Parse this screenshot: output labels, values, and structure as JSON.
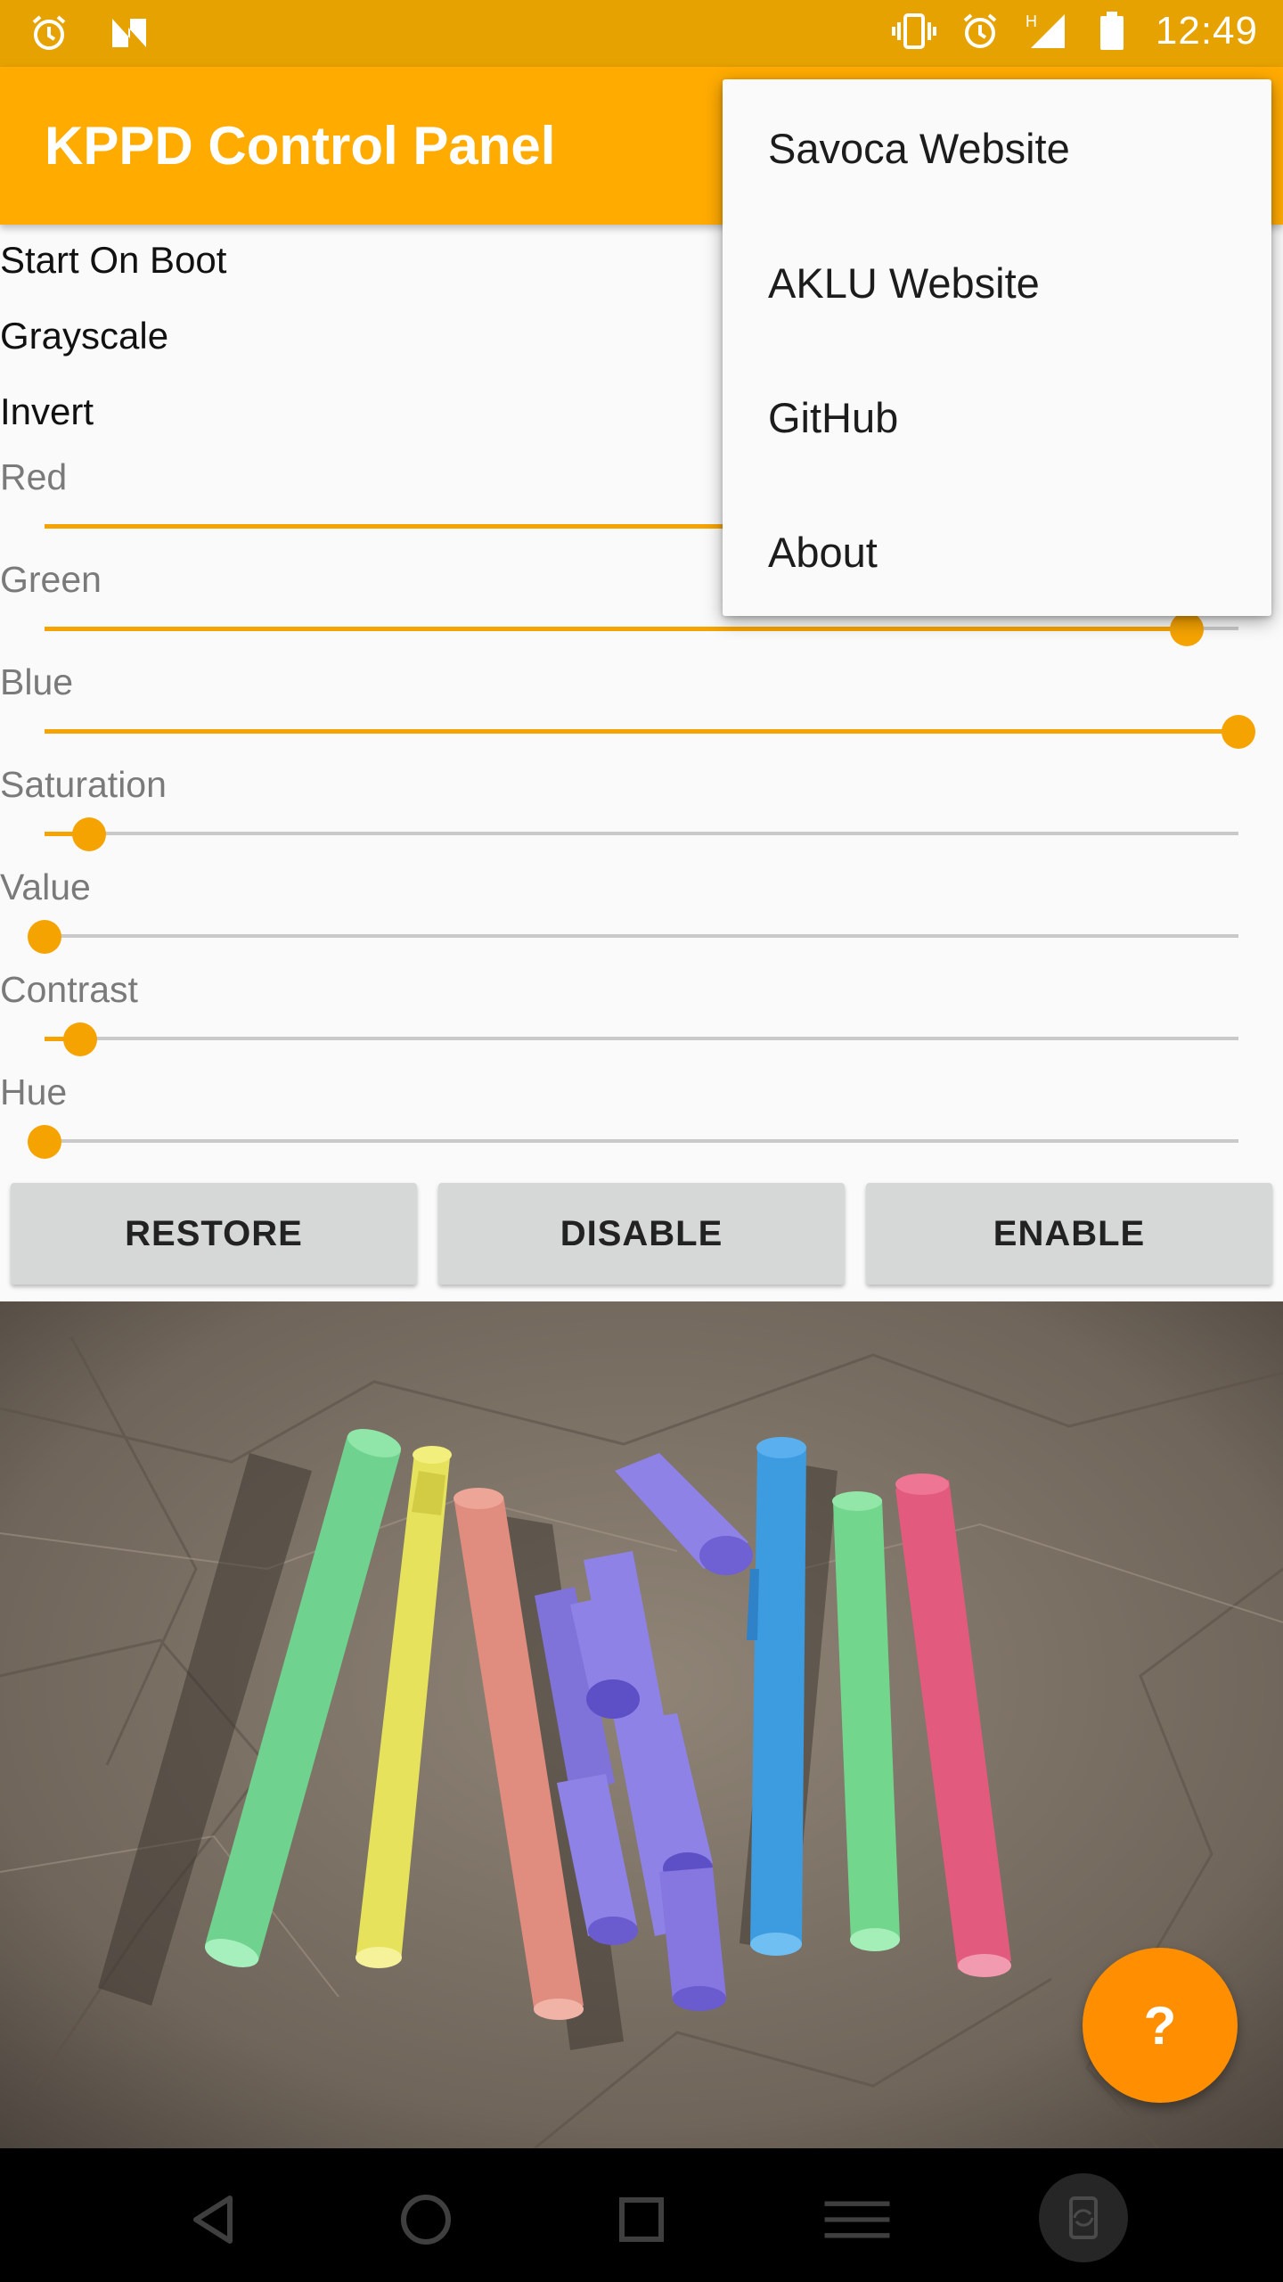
{
  "status_bar": {
    "time": "12:49",
    "icons": [
      "alarm-icon",
      "n-logo-icon",
      "vibrate-icon",
      "alarm-icon",
      "signal-icon",
      "battery-icon"
    ],
    "network_type": "H"
  },
  "app_bar": {
    "title": "KPPD Control Panel"
  },
  "toggles": [
    {
      "label": "Start On Boot"
    },
    {
      "label": "Grayscale"
    },
    {
      "label": "Invert"
    }
  ],
  "sliders": [
    {
      "label": "Red",
      "value_fraction": 1.0
    },
    {
      "label": "Green",
      "value_fraction": 0.957
    },
    {
      "label": "Blue",
      "value_fraction": 1.0
    },
    {
      "label": "Saturation",
      "value_fraction": 0.037
    },
    {
      "label": "Value",
      "value_fraction": 0.0
    },
    {
      "label": "Contrast",
      "value_fraction": 0.03
    },
    {
      "label": "Hue",
      "value_fraction": 0.0
    }
  ],
  "buttons": {
    "restore": "RESTORE",
    "disable": "DISABLE",
    "enable": "ENABLE"
  },
  "fab": {
    "label": "?"
  },
  "overflow_menu": {
    "items": [
      "Savoca Website",
      "AKLU Website",
      "GitHub",
      "About"
    ]
  },
  "colors": {
    "status_bar": "#e6a200",
    "app_bar": "#ffab00",
    "accent": "#f5a300",
    "fab": "#ff8f00"
  }
}
